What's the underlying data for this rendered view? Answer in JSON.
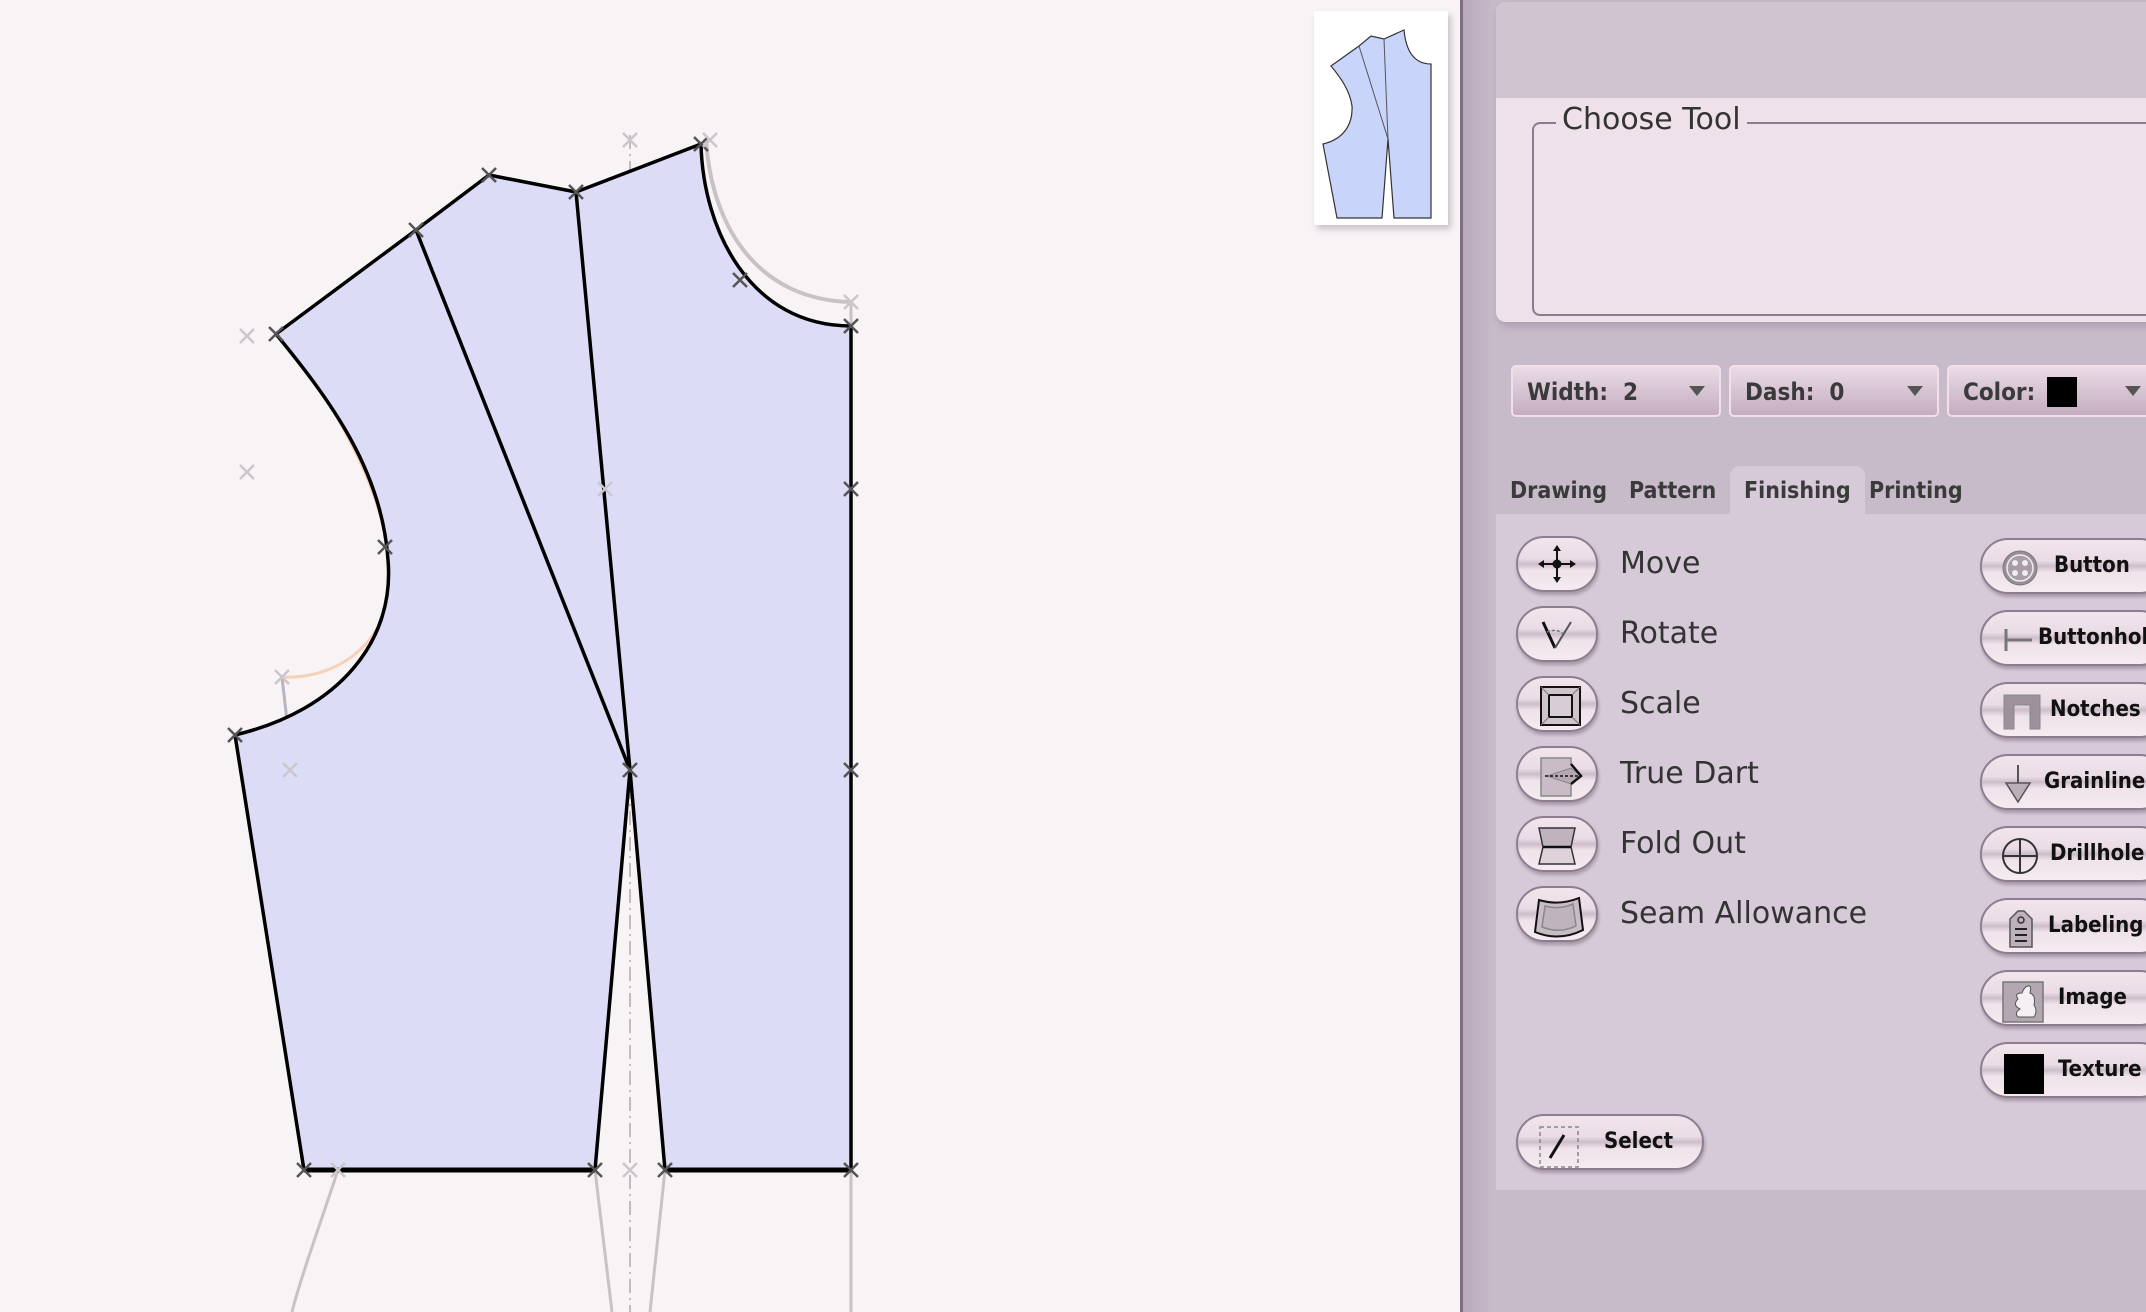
{
  "canvas": {
    "background": "#f8f3f5",
    "piece_fill": "#dcdcf7",
    "thumbnail_fill": "#c8d4fa"
  },
  "panel": {
    "choose_tool_label": "Choose Tool",
    "width_dropdown": {
      "label": "Width:",
      "value": "2"
    },
    "dash_dropdown": {
      "label": "Dash:",
      "value": "0"
    },
    "color_dropdown": {
      "label": "Color:",
      "value": "#000000"
    },
    "tabs": [
      {
        "label": "Drawing",
        "active": false
      },
      {
        "label": "Pattern",
        "active": false
      },
      {
        "label": "Finishing",
        "active": true
      },
      {
        "label": "Printing",
        "active": false
      }
    ],
    "tools": [
      {
        "label": "Move",
        "icon": "move-icon"
      },
      {
        "label": "Rotate",
        "icon": "rotate-icon"
      },
      {
        "label": "Scale",
        "icon": "scale-icon"
      },
      {
        "label": "True Dart",
        "icon": "true-dart-icon"
      },
      {
        "label": "Fold Out",
        "icon": "fold-out-icon"
      },
      {
        "label": "Seam Allowance",
        "icon": "seam-allowance-icon"
      }
    ],
    "finishing_buttons": [
      {
        "label": "Button",
        "icon": "button-icon"
      },
      {
        "label": "Buttonhole",
        "icon": "buttonhole-icon"
      },
      {
        "label": "Notches",
        "icon": "notches-icon"
      },
      {
        "label": "Grainline",
        "icon": "grainline-icon"
      },
      {
        "label": "Drillhole",
        "icon": "drillhole-icon"
      },
      {
        "label": "Labeling",
        "icon": "labeling-icon"
      },
      {
        "label": "Image",
        "icon": "image-icon"
      },
      {
        "label": "Texture",
        "icon": "texture-icon"
      }
    ],
    "select_button": {
      "label": "Select",
      "icon": "select-icon"
    }
  }
}
